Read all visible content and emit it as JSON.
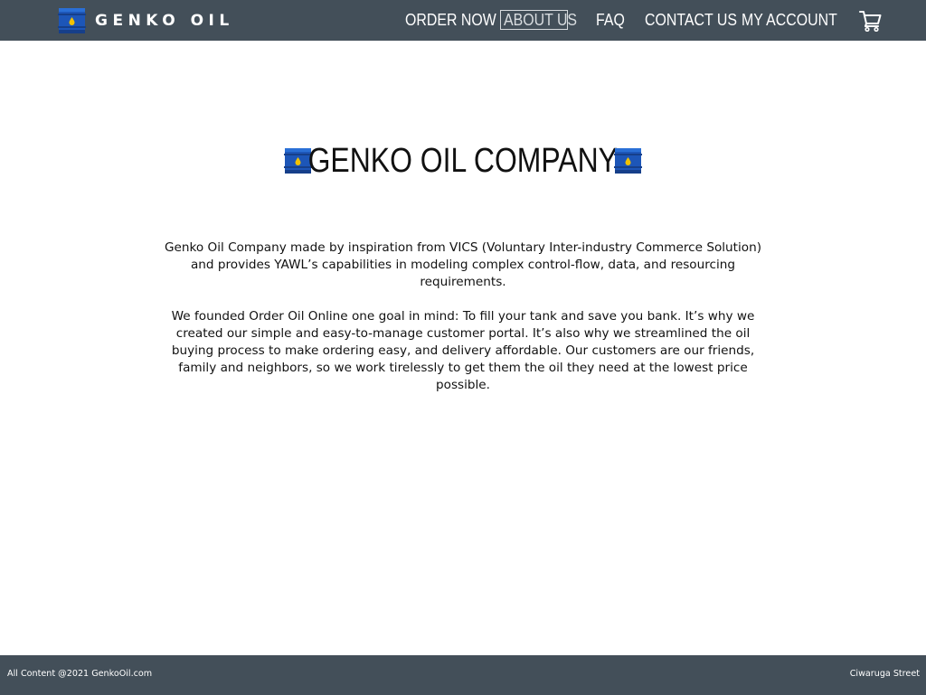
{
  "header": {
    "brand": {
      "logo_icon": "oil-barrel-icon",
      "name": "GENKO OIL"
    },
    "nav": [
      {
        "label": "ORDER NOW",
        "active": false
      },
      {
        "label": "ABOUT US",
        "active": true
      },
      {
        "label": "FAQ",
        "active": false
      },
      {
        "label": "CONTACT US",
        "active": false
      },
      {
        "label": "MY ACCOUNT",
        "active": false
      }
    ],
    "cart_icon": "shopping-cart-icon"
  },
  "main": {
    "title": "GENKO OIL COMPANY",
    "title_icon": "oil-barrel-icon",
    "paragraphs": [
      "Genko Oil Company made by inspiration from VICS (Voluntary Inter-industry Commerce Solution) and provides YAWL’s capabilities in modeling complex control-flow, data, and resourcing requirements.",
      "We founded Order Oil Online one goal in mind: To fill your tank and save you bank. It’s why we created our simple and easy-to-manage customer portal. It’s also why we streamlined the oil buying process to make ordering easy, and delivery affordable. Our customers are our friends, family and neighbors, so we work tirelessly to get them the oil they need at the lowest price possible."
    ]
  },
  "footer": {
    "left": "All Content @2021 GenkoOil.com",
    "right": "Ciwaruga Street"
  },
  "colors": {
    "header_bg": "#434f59",
    "footer_bg": "#434f59",
    "barrel_blue": "#1f5fc4",
    "oil_drop": "#f2c200"
  }
}
